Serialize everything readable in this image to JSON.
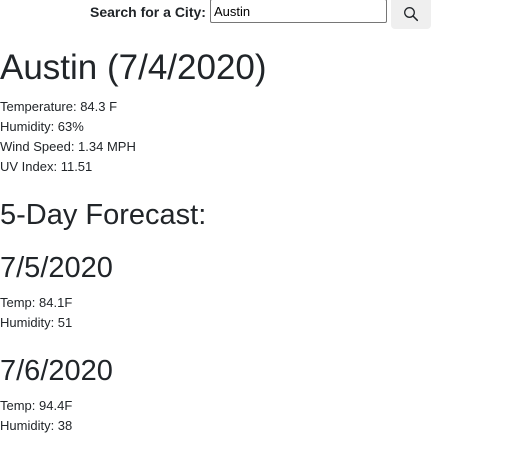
{
  "search": {
    "label": "Search for a City:",
    "value": "Austin",
    "button_icon": "search-icon"
  },
  "current": {
    "title": "Austin (7/4/2020)",
    "temperature": "Temperature: 84.3 F",
    "humidity": "Humidity: 63%",
    "wind_speed": "Wind Speed: 1.34 MPH",
    "uv_index": "UV Index: 11.51"
  },
  "forecast": {
    "heading": "5-Day Forecast:",
    "days": [
      {
        "date": "7/5/2020",
        "temp": "Temp: 84.1F",
        "humidity": "Humidity: 51"
      },
      {
        "date": "7/6/2020",
        "temp": "Temp: 94.4F",
        "humidity": "Humidity: 38"
      }
    ]
  }
}
